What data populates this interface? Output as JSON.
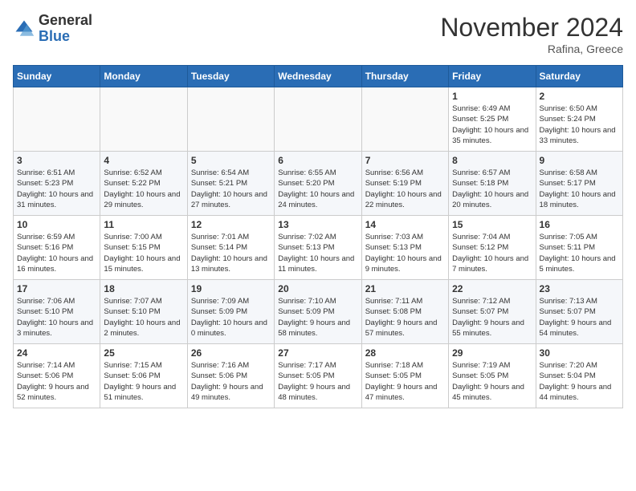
{
  "logo": {
    "general": "General",
    "blue": "Blue"
  },
  "title": "November 2024",
  "subtitle": "Rafina, Greece",
  "days_of_week": [
    "Sunday",
    "Monday",
    "Tuesday",
    "Wednesday",
    "Thursday",
    "Friday",
    "Saturday"
  ],
  "weeks": [
    [
      {
        "day": "",
        "info": ""
      },
      {
        "day": "",
        "info": ""
      },
      {
        "day": "",
        "info": ""
      },
      {
        "day": "",
        "info": ""
      },
      {
        "day": "",
        "info": ""
      },
      {
        "day": "1",
        "info": "Sunrise: 6:49 AM\nSunset: 5:25 PM\nDaylight: 10 hours and 35 minutes."
      },
      {
        "day": "2",
        "info": "Sunrise: 6:50 AM\nSunset: 5:24 PM\nDaylight: 10 hours and 33 minutes."
      }
    ],
    [
      {
        "day": "3",
        "info": "Sunrise: 6:51 AM\nSunset: 5:23 PM\nDaylight: 10 hours and 31 minutes."
      },
      {
        "day": "4",
        "info": "Sunrise: 6:52 AM\nSunset: 5:22 PM\nDaylight: 10 hours and 29 minutes."
      },
      {
        "day": "5",
        "info": "Sunrise: 6:54 AM\nSunset: 5:21 PM\nDaylight: 10 hours and 27 minutes."
      },
      {
        "day": "6",
        "info": "Sunrise: 6:55 AM\nSunset: 5:20 PM\nDaylight: 10 hours and 24 minutes."
      },
      {
        "day": "7",
        "info": "Sunrise: 6:56 AM\nSunset: 5:19 PM\nDaylight: 10 hours and 22 minutes."
      },
      {
        "day": "8",
        "info": "Sunrise: 6:57 AM\nSunset: 5:18 PM\nDaylight: 10 hours and 20 minutes."
      },
      {
        "day": "9",
        "info": "Sunrise: 6:58 AM\nSunset: 5:17 PM\nDaylight: 10 hours and 18 minutes."
      }
    ],
    [
      {
        "day": "10",
        "info": "Sunrise: 6:59 AM\nSunset: 5:16 PM\nDaylight: 10 hours and 16 minutes."
      },
      {
        "day": "11",
        "info": "Sunrise: 7:00 AM\nSunset: 5:15 PM\nDaylight: 10 hours and 15 minutes."
      },
      {
        "day": "12",
        "info": "Sunrise: 7:01 AM\nSunset: 5:14 PM\nDaylight: 10 hours and 13 minutes."
      },
      {
        "day": "13",
        "info": "Sunrise: 7:02 AM\nSunset: 5:13 PM\nDaylight: 10 hours and 11 minutes."
      },
      {
        "day": "14",
        "info": "Sunrise: 7:03 AM\nSunset: 5:13 PM\nDaylight: 10 hours and 9 minutes."
      },
      {
        "day": "15",
        "info": "Sunrise: 7:04 AM\nSunset: 5:12 PM\nDaylight: 10 hours and 7 minutes."
      },
      {
        "day": "16",
        "info": "Sunrise: 7:05 AM\nSunset: 5:11 PM\nDaylight: 10 hours and 5 minutes."
      }
    ],
    [
      {
        "day": "17",
        "info": "Sunrise: 7:06 AM\nSunset: 5:10 PM\nDaylight: 10 hours and 3 minutes."
      },
      {
        "day": "18",
        "info": "Sunrise: 7:07 AM\nSunset: 5:10 PM\nDaylight: 10 hours and 2 minutes."
      },
      {
        "day": "19",
        "info": "Sunrise: 7:09 AM\nSunset: 5:09 PM\nDaylight: 10 hours and 0 minutes."
      },
      {
        "day": "20",
        "info": "Sunrise: 7:10 AM\nSunset: 5:09 PM\nDaylight: 9 hours and 58 minutes."
      },
      {
        "day": "21",
        "info": "Sunrise: 7:11 AM\nSunset: 5:08 PM\nDaylight: 9 hours and 57 minutes."
      },
      {
        "day": "22",
        "info": "Sunrise: 7:12 AM\nSunset: 5:07 PM\nDaylight: 9 hours and 55 minutes."
      },
      {
        "day": "23",
        "info": "Sunrise: 7:13 AM\nSunset: 5:07 PM\nDaylight: 9 hours and 54 minutes."
      }
    ],
    [
      {
        "day": "24",
        "info": "Sunrise: 7:14 AM\nSunset: 5:06 PM\nDaylight: 9 hours and 52 minutes."
      },
      {
        "day": "25",
        "info": "Sunrise: 7:15 AM\nSunset: 5:06 PM\nDaylight: 9 hours and 51 minutes."
      },
      {
        "day": "26",
        "info": "Sunrise: 7:16 AM\nSunset: 5:06 PM\nDaylight: 9 hours and 49 minutes."
      },
      {
        "day": "27",
        "info": "Sunrise: 7:17 AM\nSunset: 5:05 PM\nDaylight: 9 hours and 48 minutes."
      },
      {
        "day": "28",
        "info": "Sunrise: 7:18 AM\nSunset: 5:05 PM\nDaylight: 9 hours and 47 minutes."
      },
      {
        "day": "29",
        "info": "Sunrise: 7:19 AM\nSunset: 5:05 PM\nDaylight: 9 hours and 45 minutes."
      },
      {
        "day": "30",
        "info": "Sunrise: 7:20 AM\nSunset: 5:04 PM\nDaylight: 9 hours and 44 minutes."
      }
    ]
  ]
}
